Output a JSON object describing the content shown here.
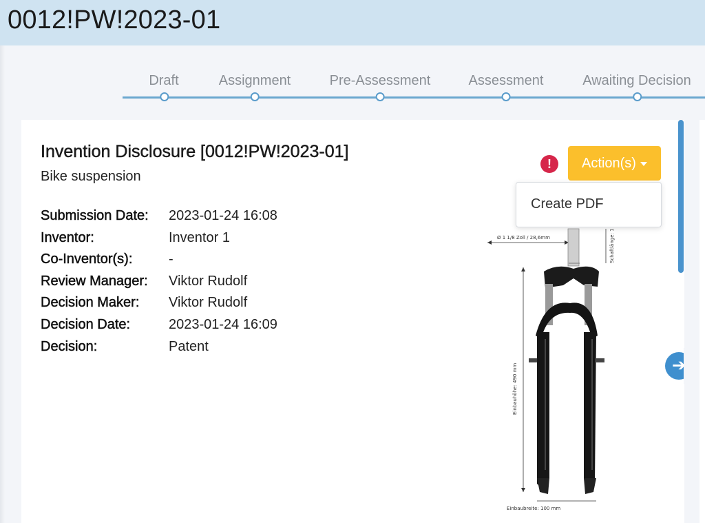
{
  "header": {
    "title": "0012!PW!2023-01"
  },
  "stepper": {
    "steps": [
      "Draft",
      "Assignment",
      "Pre-Assessment",
      "Assessment",
      "Awaiting Decision"
    ]
  },
  "card": {
    "title": "Invention Disclosure [0012!PW!2023-01]",
    "subtitle": "Bike suspension",
    "details": [
      {
        "label": "Submission Date:",
        "value": "2023-01-24 16:08"
      },
      {
        "label": "Inventor:",
        "value": "Inventor 1"
      },
      {
        "label": "Co-Inventor(s):",
        "value": "-"
      },
      {
        "label": "Review Manager:",
        "value": "Viktor Rudolf"
      },
      {
        "label": "Decision Maker:",
        "value": "Viktor Rudolf"
      },
      {
        "label": "Decision Date:",
        "value": "2023-01-24 16:09"
      },
      {
        "label": "Decision:",
        "value": "Patent"
      }
    ],
    "alert_icon": "exclamation-circle-icon",
    "action_button": {
      "label": "Action(s)"
    },
    "dropdown": {
      "items": [
        "Create PDF"
      ]
    },
    "figure": {
      "top_dimension": "Ø 1 1/8 Zoll / 28,6mm",
      "side_dimension": "Schaftlänge: 1",
      "height_dimension": "Einbauhöhe: 490 mm",
      "width_dimension": "Einbaubreite: 100 mm"
    },
    "next_icon": "arrow-right-icon"
  },
  "colors": {
    "header_bg": "#cfe3f1",
    "accent": "#4a93cd",
    "action": "#fbbf2c",
    "alert": "#d6264a"
  }
}
